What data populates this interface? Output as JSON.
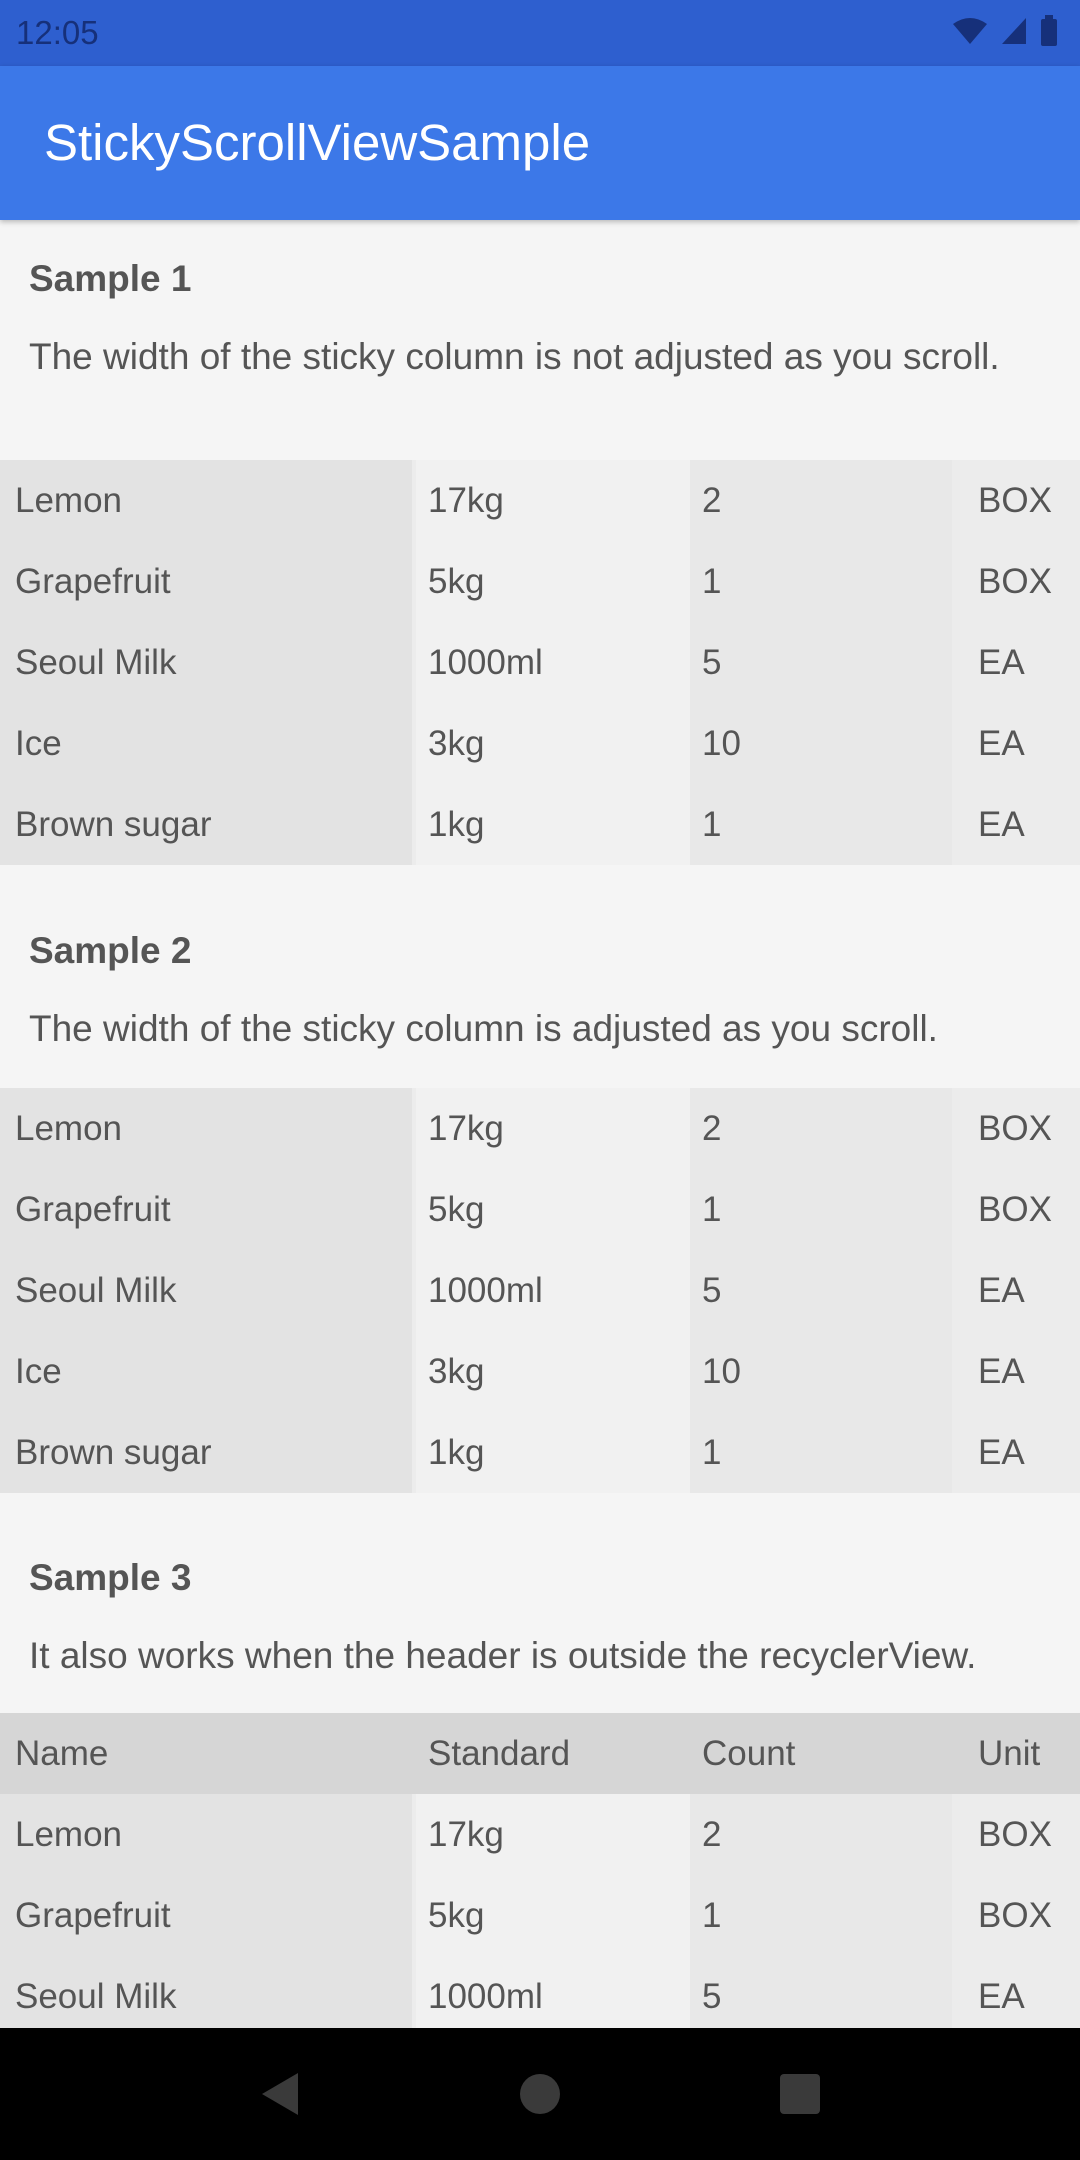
{
  "status": {
    "time": "12:05"
  },
  "app": {
    "title": "StickyScrollViewSample"
  },
  "sample1": {
    "title": "Sample 1",
    "description": "The width of the sticky column is not adjusted as you scroll.",
    "rows": [
      [
        "Lemon",
        "17kg",
        "2",
        "BOX"
      ],
      [
        "Grapefruit",
        "5kg",
        "1",
        "BOX"
      ],
      [
        "Seoul Milk",
        "1000ml",
        "5",
        "EA"
      ],
      [
        "Ice",
        "3kg",
        "10",
        "EA"
      ],
      [
        "Brown sugar",
        "1kg",
        "1",
        "EA"
      ]
    ]
  },
  "sample2": {
    "title": "Sample 2",
    "description": "The width of the sticky column is adjusted as you scroll.",
    "rows": [
      [
        "Lemon",
        "17kg",
        "2",
        "BOX"
      ],
      [
        "Grapefruit",
        "5kg",
        "1",
        "BOX"
      ],
      [
        "Seoul Milk",
        "1000ml",
        "5",
        "EA"
      ],
      [
        "Ice",
        "3kg",
        "10",
        "EA"
      ],
      [
        "Brown sugar",
        "1kg",
        "1",
        "EA"
      ]
    ]
  },
  "sample3": {
    "title": "Sample 3",
    "description": "It also works when the header is outside the recyclerView.",
    "header": [
      "Name",
      "Standard",
      "Count",
      "Unit"
    ],
    "rows": [
      [
        "Lemon",
        "17kg",
        "2",
        "BOX"
      ],
      [
        "Grapefruit",
        "5kg",
        "1",
        "BOX"
      ],
      [
        "Seoul Milk",
        "1000ml",
        "5",
        "EA"
      ]
    ]
  },
  "colors": {
    "app_bar": "#3c78e8",
    "status_bar": "#2e5fcf"
  }
}
